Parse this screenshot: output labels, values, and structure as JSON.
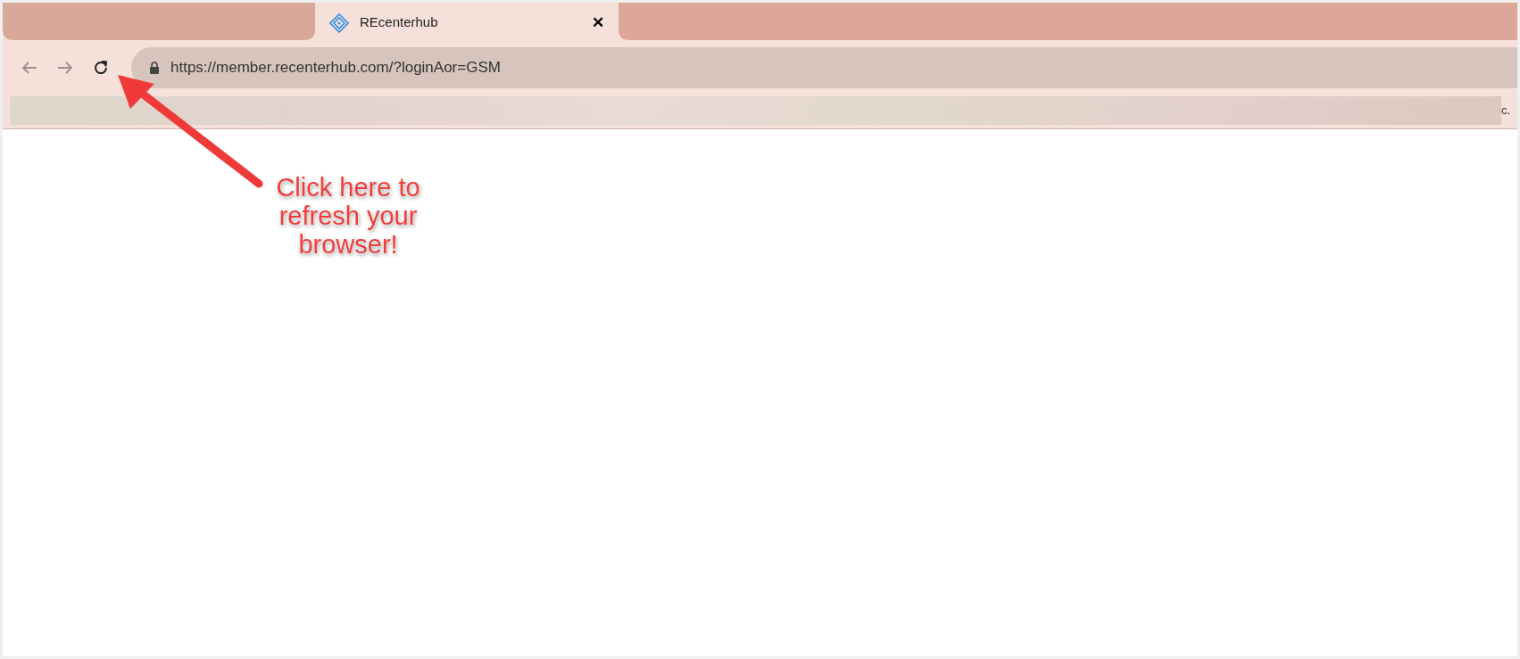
{
  "tab": {
    "title": "REcenterhub",
    "close": "✕",
    "selected": true
  },
  "toolbar": {
    "back_disabled": true,
    "forward_disabled": true,
    "url": "https://member.recenterhub.com/?loginAor=GSM"
  },
  "bookmarks_bar": {
    "overflow": "c."
  },
  "annotation": {
    "text": "Click here to refresh your browser!"
  }
}
